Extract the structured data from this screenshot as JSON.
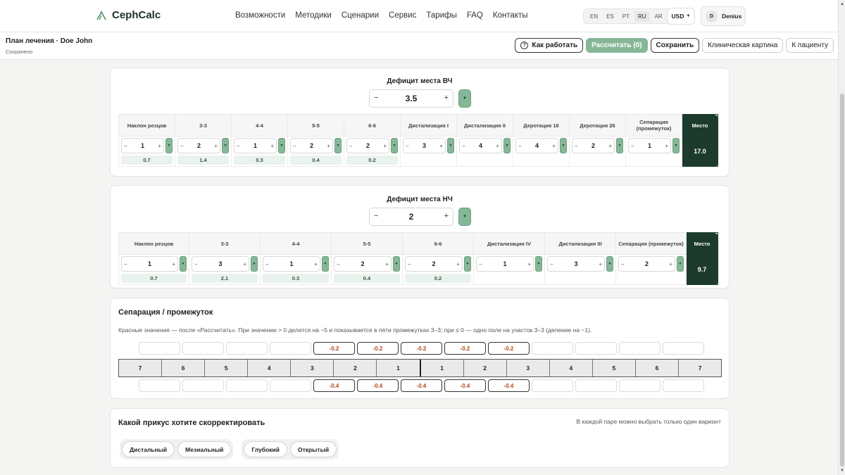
{
  "nav": {
    "brand": "CephCalc",
    "links": [
      "Возможности",
      "Методики",
      "Сценарии",
      "Сервис",
      "Тарифы",
      "FAQ",
      "Контакты"
    ],
    "languages": [
      "EN",
      "ES",
      "PT",
      "RU",
      "AR"
    ],
    "active_language": "RU",
    "currency": "USD",
    "user_initial": "D",
    "user_name": "Denius"
  },
  "plan": {
    "title": "План лечения · Doe John",
    "status": "Сохранено",
    "how_btn": "Как работать",
    "calc_btn": "Рассчитать (0)",
    "save_btn": "Сохранить",
    "clinical_btn": "Клиническая картина",
    "patient_btn": "К пациенту"
  },
  "upper": {
    "title": "Дефицит места ВЧ",
    "deficit": "3.5",
    "columns": [
      "Наклон резцов",
      "3-3",
      "4-4",
      "5-5",
      "6-6",
      "Дистализация I",
      "Дистализация II",
      "Деротация 16",
      "Деротация 26",
      "Сепарация (промежуток)"
    ],
    "values": [
      "1",
      "2",
      "1",
      "2",
      "2",
      "3",
      "4",
      "4",
      "2",
      "1"
    ],
    "results": [
      "0.7",
      "1.4",
      "0.3",
      "0.4",
      "0.2",
      "",
      "",
      "",
      "",
      ""
    ],
    "total_label": "Место",
    "total": "17.0"
  },
  "lower": {
    "title": "Дефицит места НЧ",
    "deficit": "2",
    "columns": [
      "Наклон резцов",
      "3-3",
      "4-4",
      "5-5",
      "6-6",
      "Дистализация IV",
      "Дистализация III",
      "Сепарация (промежуток)"
    ],
    "values": [
      "1",
      "3",
      "1",
      "2",
      "2",
      "1",
      "3",
      "2"
    ],
    "results": [
      "0.7",
      "2.1",
      "0.3",
      "0.4",
      "0.2",
      "",
      "",
      ""
    ],
    "total_label": "Место",
    "total": "9.7"
  },
  "separation": {
    "title": "Сепарация / промежуток",
    "hint": "Красные значения — после «Рассчитать». При значении > 0 делится на −5 и показывается в пяти промежутках 3–3; при ≤ 0 — одно поле на участок 3–3 (деление на −1).",
    "upper_values": [
      "",
      "",
      "",
      "",
      "-0.2",
      "-0.2",
      "-0.2",
      "-0.2",
      "-0.2",
      "",
      "",
      "",
      ""
    ],
    "teeth": [
      "7",
      "6",
      "5",
      "4",
      "3",
      "2",
      "1",
      "1",
      "2",
      "3",
      "4",
      "5",
      "6",
      "7"
    ],
    "lower_values": [
      "",
      "",
      "",
      "",
      "-0.4",
      "-0.4",
      "-0.4",
      "-0.4",
      "-0.4",
      "",
      "",
      "",
      ""
    ]
  },
  "bite": {
    "title": "Какой прикус хотите скорректировать",
    "note": "В каждой паре можно выбрать только один вариант",
    "pairs": [
      [
        "Дистальный",
        "Мезиальный"
      ],
      [
        "Глубокий",
        "Открытый"
      ]
    ]
  },
  "colors": {
    "accent": "#86b797",
    "dark_green": "#1c3b2c",
    "red_value": "#b24a19"
  }
}
